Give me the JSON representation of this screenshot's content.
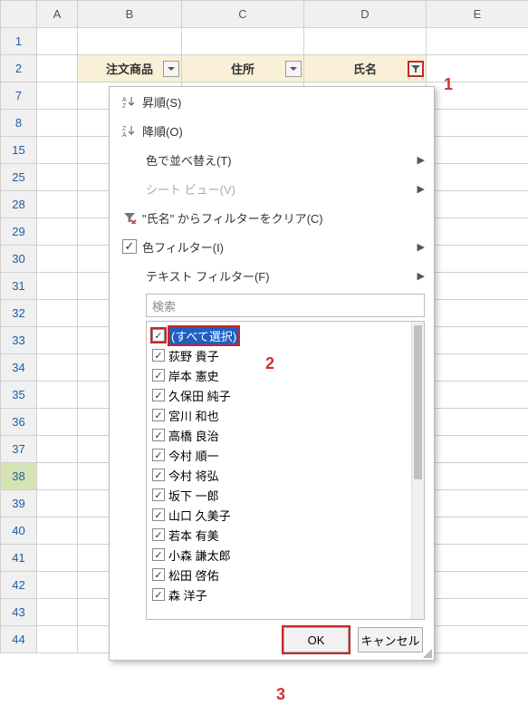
{
  "columns": [
    "A",
    "B",
    "C",
    "D",
    "E"
  ],
  "row_numbers": [
    1,
    2,
    7,
    8,
    15,
    25,
    28,
    29,
    30,
    31,
    32,
    33,
    34,
    35,
    36,
    37,
    38,
    39,
    40,
    41,
    42,
    43,
    44
  ],
  "selected_row_index": 16,
  "table_headers": {
    "B": "注文商品",
    "C": "住所",
    "D": "氏名"
  },
  "filter_active_column": "D",
  "menu": {
    "sort_asc": "昇順(S)",
    "sort_desc": "降順(O)",
    "sort_by_color": "色で並べ替え(T)",
    "sheet_view": "シート ビュー(V)",
    "clear_filter": "\"氏名\" からフィルターをクリア(C)",
    "color_filter": "色フィルター(I)",
    "text_filter": "テキスト フィルター(F)",
    "search_placeholder": "検索"
  },
  "filter_items": [
    {
      "label": "(すべて選択)",
      "checked": true,
      "select_all": true
    },
    {
      "label": "荻野 貴子",
      "checked": true
    },
    {
      "label": "岸本 憲史",
      "checked": true
    },
    {
      "label": "久保田 純子",
      "checked": true
    },
    {
      "label": "宮川 和也",
      "checked": true
    },
    {
      "label": "高橋 良治",
      "checked": true
    },
    {
      "label": "今村 順一",
      "checked": true
    },
    {
      "label": "今村 将弘",
      "checked": true
    },
    {
      "label": "坂下 一郎",
      "checked": true
    },
    {
      "label": "山口 久美子",
      "checked": true
    },
    {
      "label": "若本 有美",
      "checked": true
    },
    {
      "label": "小森 謙太郎",
      "checked": true
    },
    {
      "label": "松田 啓佑",
      "checked": true
    },
    {
      "label": "森 洋子",
      "checked": true
    }
  ],
  "buttons": {
    "ok": "OK",
    "cancel": "キャンセル"
  },
  "annotations": {
    "a1": "1",
    "a2": "2",
    "a3": "3"
  }
}
